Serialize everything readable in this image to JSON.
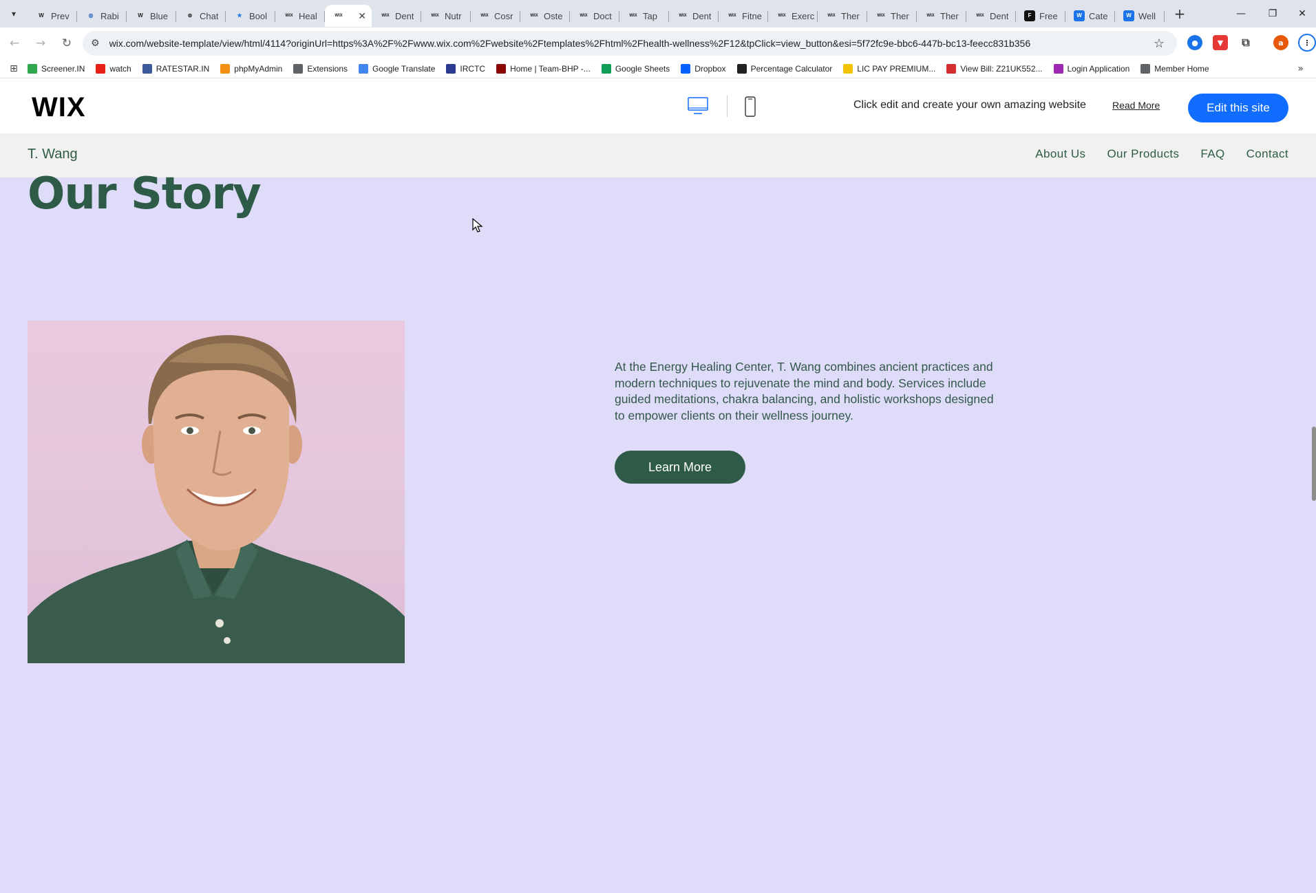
{
  "browser": {
    "tabs": [
      {
        "label": "Prev",
        "icon": "W"
      },
      {
        "label": "Rabi",
        "icon": "globe"
      },
      {
        "label": "Blue",
        "icon": "W"
      },
      {
        "label": "Chat",
        "icon": "openai"
      },
      {
        "label": "Bool",
        "icon": "star"
      },
      {
        "label": "Heal",
        "icon": "wix"
      },
      {
        "label": "",
        "icon": "wix",
        "active": true
      },
      {
        "label": "Dent",
        "icon": "wix"
      },
      {
        "label": "Nutr",
        "icon": "wix"
      },
      {
        "label": "Cosr",
        "icon": "wix"
      },
      {
        "label": "Oste",
        "icon": "wix"
      },
      {
        "label": "Doct",
        "icon": "wix"
      },
      {
        "label": "Tap",
        "icon": "wix"
      },
      {
        "label": "Dent",
        "icon": "wix"
      },
      {
        "label": "Fitne",
        "icon": "wix"
      },
      {
        "label": "Exerc",
        "icon": "wix"
      },
      {
        "label": "Ther",
        "icon": "wix"
      },
      {
        "label": "Ther",
        "icon": "wix"
      },
      {
        "label": "Ther",
        "icon": "wix"
      },
      {
        "label": "Dent",
        "icon": "wix"
      },
      {
        "label": "Free",
        "icon": "framer"
      },
      {
        "label": "Cate",
        "icon": "blue-w"
      },
      {
        "label": "Well",
        "icon": "blue-w"
      }
    ],
    "url": "wix.com/website-template/view/html/4114?originUrl=https%3A%2F%2Fwww.wix.com%2Fwebsite%2Ftemplates%2Fhtml%2Fhealth-wellness%2F12&tpClick=view_button&esi=5f72fc9e-bbc6-447b-bc13-feecc831b356",
    "profile_initial": "a",
    "bookmarks": [
      {
        "label": "Screener.IN",
        "color": "#2fa84f"
      },
      {
        "label": "watch",
        "color": "#e62117"
      },
      {
        "label": "RATESTAR.IN",
        "color": "#3b5998"
      },
      {
        "label": "phpMyAdmin",
        "color": "#f29111"
      },
      {
        "label": "Extensions",
        "color": "#5f6368"
      },
      {
        "label": "Google Translate",
        "color": "#4285f4"
      },
      {
        "label": "IRCTC",
        "color": "#2b3990"
      },
      {
        "label": "Home | Team-BHP -...",
        "color": "#8b0000"
      },
      {
        "label": "Google Sheets",
        "color": "#0f9d58"
      },
      {
        "label": "Dropbox",
        "color": "#0061fe"
      },
      {
        "label": "Percentage Calculator",
        "color": "#222222"
      },
      {
        "label": "LIC PAY PREMIUM...",
        "color": "#f4c300"
      },
      {
        "label": "View Bill: Z21UK552...",
        "color": "#d32f2f"
      },
      {
        "label": "Login Application",
        "color": "#9c27b0"
      },
      {
        "label": "Member Home",
        "color": "#5f6368"
      }
    ]
  },
  "wix_bar": {
    "logo": "WIX",
    "message": "Click edit and create your own amazing website",
    "read_more": "Read More",
    "edit_button": "Edit this site"
  },
  "site": {
    "brand": "T. Wang",
    "nav": [
      "About Us",
      "Our Products",
      "FAQ",
      "Contact"
    ],
    "heading": "Our Story",
    "body": "At the Energy Healing Center, T. Wang combines ancient practices and modern techniques to rejuvenate the mind and body. Services include guided meditations, chakra balancing, and holistic workshops designed to empower clients on their wellness journey.",
    "cta": "Learn More"
  },
  "colors": {
    "page_bg": "#dedcf9",
    "brand_green": "#2e5b47",
    "wix_blue": "#116dff"
  }
}
